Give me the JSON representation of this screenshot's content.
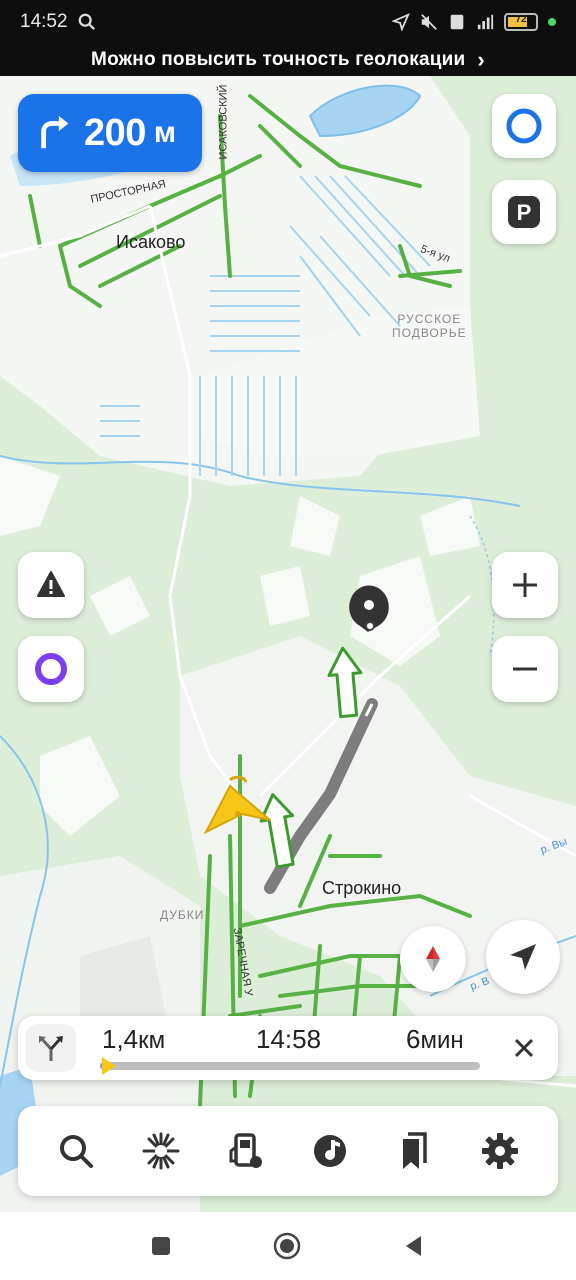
{
  "status_bar": {
    "time": "14:52",
    "battery_level": "72",
    "icons": [
      "search-icon",
      "location-arrow-icon",
      "mute-icon",
      "sim-icon",
      "signal-icon",
      "battery-icon"
    ]
  },
  "banner": {
    "text": "Можно повысить точность геолокации",
    "chevron": "›"
  },
  "turn": {
    "distance": "200",
    "unit": "м",
    "direction": "right"
  },
  "map": {
    "places": {
      "isakovo": "Исаково",
      "russkoe_podvorye": "РУССКОЕ\nПОДВОРЬЕ",
      "strokino": "Строкино",
      "dubki": "ДУБКИ"
    },
    "streets": {
      "prostornaya": "ПРОСТОРНАЯ",
      "isakovsky": "ИСАКОВСКИЙ",
      "fifth": "5-я ул",
      "zarechnaya": "ЗАРЕЧНАЯ У",
      "river_right": "р. Вы",
      "river_bottom": "р. В"
    }
  },
  "route": {
    "distance": "1,4",
    "distance_unit": "км",
    "arrival_time": "14:58",
    "duration": "6",
    "duration_unit": "мин",
    "progress": 0.02
  },
  "colors": {
    "accent": "#1a73e8",
    "route_gray": "#7d7d7d",
    "arrow_green": "#3c9a2e",
    "road_green": "#58b145",
    "water": "#a6d4f2",
    "forest": "#d6ebd3",
    "user_marker": "#f5c518"
  }
}
